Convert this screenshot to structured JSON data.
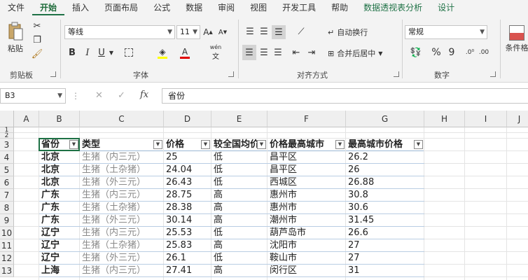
{
  "tabs": [
    "文件",
    "开始",
    "插入",
    "页面布局",
    "公式",
    "数据",
    "审阅",
    "视图",
    "开发工具",
    "帮助",
    "数据透视表分析",
    "设计"
  ],
  "ribbon": {
    "paste_label": "粘贴",
    "clipboard_label": "剪贴板",
    "font_name": "等线",
    "font_size": "11",
    "font_group_label": "字体",
    "bold": "B",
    "italic": "I",
    "underline": "U",
    "wen": "wén",
    "wrap_text": "自动换行",
    "merge_center": "合并后居中",
    "align_group_label": "对齐方式",
    "number_format": "常规",
    "percent": "%",
    "comma": "9",
    "number_group_label": "数字",
    "cond_format": "条件格"
  },
  "formula_bar": {
    "name_box": "B3",
    "cancel": "✕",
    "enter": "✓",
    "fx": "fx",
    "value": "省份"
  },
  "columns": [
    "A",
    "B",
    "C",
    "D",
    "E",
    "F",
    "G",
    "H",
    "I",
    "J"
  ],
  "rows": [
    "1",
    "2",
    "3",
    "4",
    "5",
    "6",
    "7",
    "8",
    "9",
    "10",
    "11",
    "12",
    "13"
  ],
  "table": {
    "headers": [
      "省份",
      "类型",
      "价格",
      "较全国均价",
      "价格最高城市",
      "最高城市价格"
    ],
    "data": [
      [
        "北京",
        "生猪（内三元）",
        "25",
        "低",
        "昌平区",
        "26.2"
      ],
      [
        "北京",
        "生猪（土杂猪）",
        "24.04",
        "低",
        "昌平区",
        "26"
      ],
      [
        "北京",
        "生猪（外三元）",
        "26.43",
        "低",
        "西城区",
        "26.88"
      ],
      [
        "广东",
        "生猪（内三元）",
        "28.75",
        "高",
        "惠州市",
        "30.8"
      ],
      [
        "广东",
        "生猪（土杂猪）",
        "28.38",
        "高",
        "惠州市",
        "30.6"
      ],
      [
        "广东",
        "生猪（外三元）",
        "30.14",
        "高",
        "潮州市",
        "31.45"
      ],
      [
        "辽宁",
        "生猪（内三元）",
        "25.53",
        "低",
        "葫芦岛市",
        "26.6"
      ],
      [
        "辽宁",
        "生猪（土杂猪）",
        "25.83",
        "高",
        "沈阳市",
        "27"
      ],
      [
        "辽宁",
        "生猪（外三元）",
        "26.1",
        "低",
        "鞍山市",
        "27"
      ],
      [
        "上海",
        "生猪（内三元）",
        "27.41",
        "高",
        "闵行区",
        "31"
      ]
    ]
  }
}
